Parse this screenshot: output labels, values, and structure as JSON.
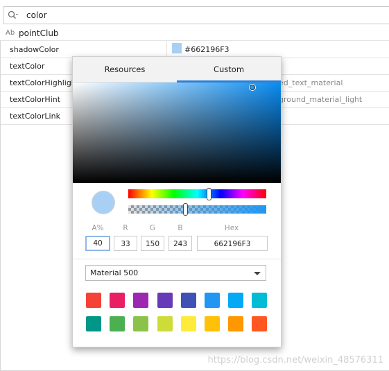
{
  "search": {
    "query": "color"
  },
  "properties": {
    "group_prefix": "Ab",
    "group_name": "pointClub",
    "rows": [
      {
        "name": "shadowColor",
        "value": "#662196F3"
      },
      {
        "name": "textColor",
        "value": ""
      },
      {
        "name": "textColorHighlight",
        "value": "ed_text_material"
      },
      {
        "name": "textColorHint",
        "value": "ground_material_light"
      },
      {
        "name": "textColorLink",
        "value": ""
      }
    ]
  },
  "picker": {
    "tabs": [
      {
        "label": "Resources"
      },
      {
        "label": "Custom"
      }
    ],
    "active_tab": "Custom",
    "preview_color": "#a8d0f5",
    "fields": {
      "labels": {
        "a": "A%",
        "r": "R",
        "g": "G",
        "b": "B",
        "hex": "Hex"
      },
      "values": {
        "a": "40",
        "r": "33",
        "g": "150",
        "b": "243",
        "hex": "662196F3"
      }
    },
    "palette_dropdown": {
      "selected": "Material 500"
    },
    "palette_colors": [
      "#f44336",
      "#e91e63",
      "#9c27b0",
      "#673ab7",
      "#3f51b5",
      "#2196f3",
      "#03a9f4",
      "#00bcd4",
      "#009688",
      "#4caf50",
      "#8bc34a",
      "#cddc39",
      "#ffeb3b",
      "#ffc107",
      "#ff9800",
      "#ff5722"
    ]
  },
  "watermark": "https://blog.csdn.net/weixin_48576311"
}
